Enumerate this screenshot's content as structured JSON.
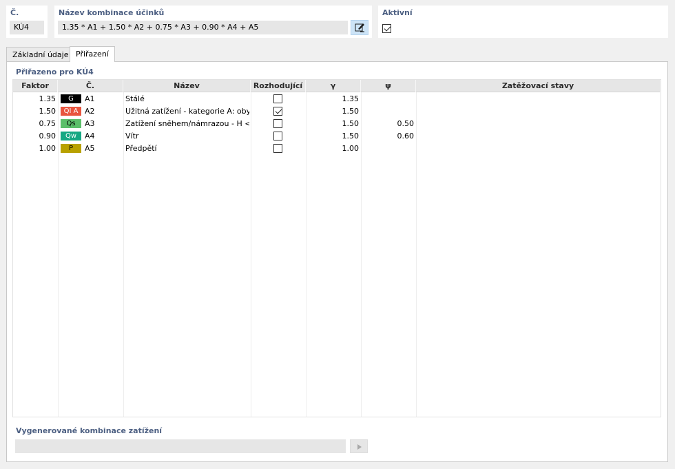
{
  "header": {
    "number": {
      "label": "Č.",
      "value": "KÚ4"
    },
    "name": {
      "label": "Název kombinace účinků",
      "value": "1.35 * A1 + 1.50 * A2 + 0.75 * A3 + 0.90 * A4 + A5"
    },
    "active": {
      "label": "Aktivní",
      "checked": true
    }
  },
  "tabs": [
    {
      "label": "Základní údaje",
      "active": false
    },
    {
      "label": "Přiřazení",
      "active": true
    }
  ],
  "assigned": {
    "title": "Přiřazeno pro KÚ4",
    "columns": [
      "Faktor",
      "Č.",
      "Název",
      "Rozhodující",
      "γ",
      "ψ",
      "Zatěžovací stavy"
    ],
    "rows": [
      {
        "factor": "1.35",
        "badge": "G",
        "badge_bg": "#000000",
        "badge_fg": "#ffffff",
        "no": "A1",
        "name": "Stálé",
        "decisive": false,
        "gamma": "1.35",
        "psi": ""
      },
      {
        "factor": "1.50",
        "badge": "QI A",
        "badge_bg": "#e8553f",
        "badge_fg": "#ffffff",
        "no": "A2",
        "name": "Užitná zatížení - kategorie A: oby...",
        "decisive": true,
        "gamma": "1.50",
        "psi": ""
      },
      {
        "factor": "0.75",
        "badge": "Qs",
        "badge_bg": "#5cbf6a",
        "badge_fg": "#000000",
        "no": "A3",
        "name": "Zatížení sněhem/námrazou - H <...",
        "decisive": false,
        "gamma": "1.50",
        "psi": "0.50"
      },
      {
        "factor": "0.90",
        "badge": "Qw",
        "badge_bg": "#16a883",
        "badge_fg": "#ffffff",
        "no": "A4",
        "name": "Vítr",
        "decisive": false,
        "gamma": "1.50",
        "psi": "0.60"
      },
      {
        "factor": "1.00",
        "badge": "P",
        "badge_bg": "#b8a100",
        "badge_fg": "#000000",
        "no": "A5",
        "name": "Předpětí",
        "decisive": false,
        "gamma": "1.00",
        "psi": ""
      }
    ]
  },
  "generated": {
    "label": "Vygenerované kombinace zatížení",
    "value": ""
  },
  "icons": {
    "edit": "edit-icon",
    "play": "play-icon"
  }
}
